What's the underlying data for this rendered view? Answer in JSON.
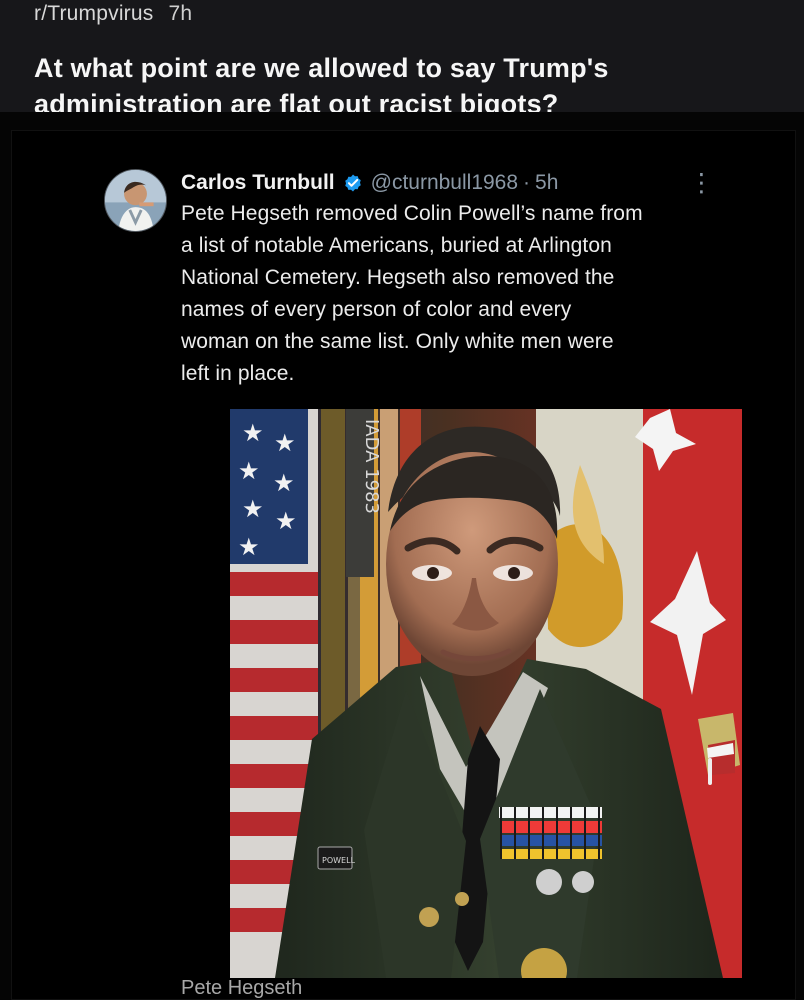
{
  "reddit": {
    "subreddit": "r/Trumpvirus",
    "time": "7h",
    "title": "At what point are we allowed to say Trump's administration are flat out racist bigots?"
  },
  "tweet": {
    "display_name": "Carlos Turnbull",
    "verified_icon": "verified-badge-icon",
    "handle": "@cturnbull1968",
    "separator": "·",
    "time": "5h",
    "more_icon": "⋮",
    "text": "Pete Hegseth removed Colin Powell’s name from\na list of notable Americans, buried at Arlington\nNational Cemetery. Hegseth also removed the\nnames of every person of color and every\nwoman on the same list. Only white men were\nleft in place.",
    "media_label": "IADA 1983",
    "nameplate": "POWELL",
    "caption": "Pete Hegseth"
  },
  "colors": {
    "header_background": "#17171a",
    "page_background": "#050505",
    "verified_blue": "#1d9bf0",
    "secondary_text": "#8b98a5"
  }
}
